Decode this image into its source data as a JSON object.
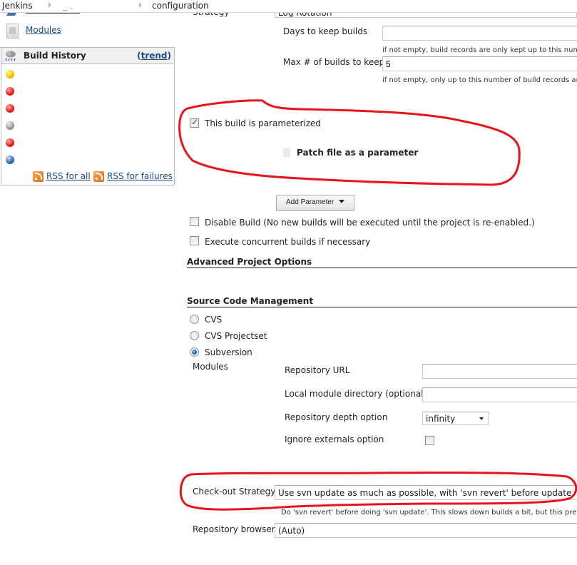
{
  "breadcrumb": {
    "items": [
      "Jenkins",
      "_ ,",
      "configuration"
    ]
  },
  "sidebar": {
    "modules_link": "Modules",
    "build_history": {
      "title": "Build History",
      "trend_open": "(",
      "trend_link": "trend",
      "trend_close": ")",
      "builds": [
        {
          "status": "yellow"
        },
        {
          "status": "red"
        },
        {
          "status": "red"
        },
        {
          "status": "grey"
        },
        {
          "status": "red"
        },
        {
          "status": "blue"
        }
      ],
      "rss_all": "RSS for all",
      "rss_failures": "RSS for failures"
    }
  },
  "form": {
    "strategy_label": "Strategy",
    "strategy_value": "Log Rotation",
    "days_to_keep_label": "Days to keep builds",
    "days_to_keep_value": "",
    "days_to_keep_help": "if not empty, build records are only kept up to this num",
    "max_builds_label": "Max # of builds to keep",
    "max_builds_value": "5",
    "max_builds_help": "if not empty, only up to this number of build records are",
    "parameterized_label": "This build is parameterized",
    "parameterized_checked": true,
    "parameter_name": "Patch file as a parameter",
    "add_parameter_label": "Add Parameter",
    "disable_build_label": "Disable Build (No new builds will be executed until the project is re-enabled.)",
    "disable_build_checked": false,
    "concurrent_label": "Execute concurrent builds if necessary",
    "concurrent_checked": false,
    "advanced_title": "Advanced Project Options",
    "scm_title": "Source Code Management",
    "scm_options": [
      {
        "label": "CVS",
        "checked": false
      },
      {
        "label": "CVS Projectset",
        "checked": false
      },
      {
        "label": "Subversion",
        "checked": true
      }
    ],
    "modules_label": "Modules",
    "repo_url_label": "Repository URL",
    "repo_url_value": "",
    "local_dir_label": "Local module directory (optional)",
    "local_dir_value": "",
    "depth_label": "Repository depth option",
    "depth_value": "infinity",
    "ignore_externals_label": "Ignore externals option",
    "ignore_externals_checked": false,
    "checkout_label": "Check-out Strategy",
    "checkout_value": "Use svn update as much as possible, with 'svn revert' before update",
    "checkout_help": "Do 'svn revert' before doing 'svn update'. This slows down builds a bit, but this prev",
    "browser_label": "Repository browser",
    "browser_value": "(Auto)"
  },
  "annotations": {
    "color": "#e8141c"
  }
}
